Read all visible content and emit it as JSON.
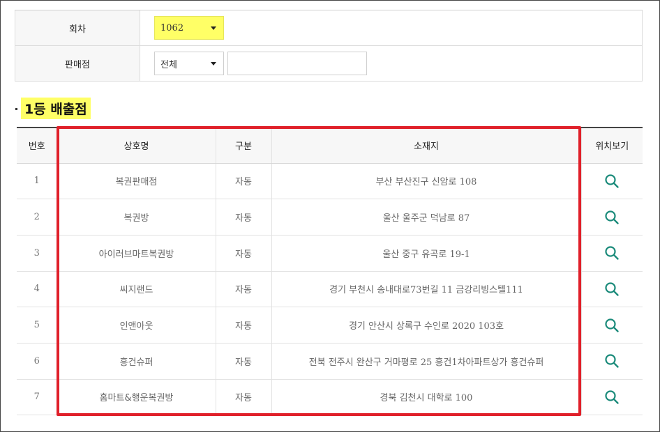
{
  "form": {
    "round_label": "회차",
    "round_value": "1062",
    "store_label": "판매점",
    "store_value": "전체",
    "store_search_value": ""
  },
  "section": {
    "title": "1등 배출점"
  },
  "table": {
    "headers": [
      "번호",
      "상호명",
      "구분",
      "소재지",
      "위치보기"
    ],
    "rows": [
      {
        "no": "1",
        "name": "복권판매점",
        "type": "자동",
        "address": "부산 부산진구 신암로 108"
      },
      {
        "no": "2",
        "name": "복권방",
        "type": "자동",
        "address": "울산 울주군 덕남로 87"
      },
      {
        "no": "3",
        "name": "아이러브마트복권방",
        "type": "자동",
        "address": "울산 중구 유곡로 19-1"
      },
      {
        "no": "4",
        "name": "씨지랜드",
        "type": "자동",
        "address": "경기 부천시 송내대로73번길 11 금강리빙스텔111"
      },
      {
        "no": "5",
        "name": "인앤아웃",
        "type": "자동",
        "address": "경기 안산시 상록구 수인로 2020 103호"
      },
      {
        "no": "6",
        "name": "흥건슈퍼",
        "type": "자동",
        "address": "전북 전주시 완산구 거마평로 25 흥건1차아파트상가 흥건슈퍼"
      },
      {
        "no": "7",
        "name": "홈마트&행운복권방",
        "type": "자동",
        "address": "경북 김천시 대학로 100"
      }
    ]
  },
  "colors": {
    "highlight": "#ffff66",
    "annotation": "#e0202a",
    "search_icon": "#1a8a7a"
  },
  "icons": {
    "location": "search-icon"
  }
}
